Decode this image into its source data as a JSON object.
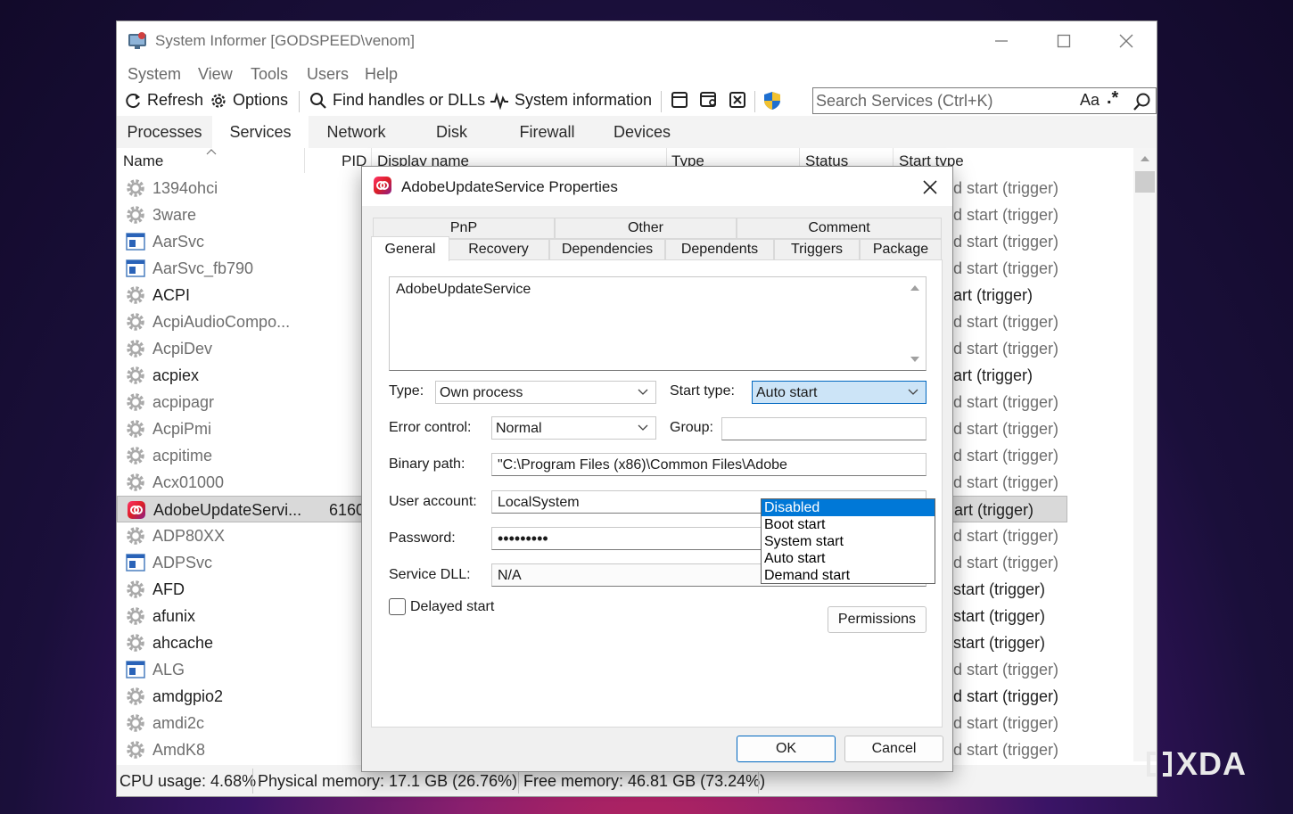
{
  "window": {
    "title": "System Informer [GODSPEED\\venom]"
  },
  "menu": [
    "System",
    "View",
    "Tools",
    "Users",
    "Help"
  ],
  "toolbar": {
    "refresh": "Refresh",
    "options": "Options",
    "find_handles": "Find handles or DLLs",
    "system_information": "System information",
    "search_placeholder": "Search Services (Ctrl+K)",
    "match_case": "Aa",
    "regex": ".*"
  },
  "tabs": [
    "Processes",
    "Services",
    "Network",
    "Disk",
    "Firewall",
    "Devices"
  ],
  "columns": {
    "name": "Name",
    "pid": "PID",
    "display_name": "Display name",
    "type": "Type",
    "status": "Status",
    "start_type": "Start type"
  },
  "services": [
    {
      "name": "1394ohci",
      "pid": "",
      "start": "d start (trigger)",
      "icon": "gear-icon"
    },
    {
      "name": "3ware",
      "pid": "",
      "start": "d start (trigger)",
      "icon": "gear-icon"
    },
    {
      "name": "AarSvc",
      "pid": "",
      "start": "d start (trigger)",
      "icon": "window-icon"
    },
    {
      "name": "AarSvc_fb790",
      "pid": "",
      "start": "d start (trigger)",
      "icon": "window-icon"
    },
    {
      "name": "ACPI",
      "pid": "",
      "start": "art (trigger)",
      "icon": "gear-icon",
      "dark": true
    },
    {
      "name": "AcpiAudioCompo...",
      "pid": "",
      "start": "d start (trigger)",
      "icon": "gear-icon"
    },
    {
      "name": "AcpiDev",
      "pid": "",
      "start": "d start (trigger)",
      "icon": "gear-icon"
    },
    {
      "name": "acpiex",
      "pid": "",
      "start": "art (trigger)",
      "icon": "gear-icon",
      "dark": true
    },
    {
      "name": "acpipagr",
      "pid": "",
      "start": "d start (trigger)",
      "icon": "gear-icon"
    },
    {
      "name": "AcpiPmi",
      "pid": "",
      "start": "d start (trigger)",
      "icon": "gear-icon"
    },
    {
      "name": "acpitime",
      "pid": "",
      "start": "d start (trigger)",
      "icon": "gear-icon"
    },
    {
      "name": "Acx01000",
      "pid": "",
      "start": "d start (trigger)",
      "icon": "gear-icon"
    },
    {
      "name": "AdobeUpdateServi...",
      "pid": "6160",
      "start": "art (trigger)",
      "icon": "adobe-icon",
      "dark": true,
      "selected": true
    },
    {
      "name": "ADP80XX",
      "pid": "",
      "start": "d start (trigger)",
      "icon": "gear-icon"
    },
    {
      "name": "ADPSvc",
      "pid": "",
      "start": "d start (trigger)",
      "icon": "window-icon"
    },
    {
      "name": "AFD",
      "pid": "",
      "start": "start (trigger)",
      "icon": "gear-icon",
      "dark": true
    },
    {
      "name": "afunix",
      "pid": "",
      "start": "start (trigger)",
      "icon": "gear-icon",
      "dark": true
    },
    {
      "name": "ahcache",
      "pid": "",
      "start": "start (trigger)",
      "icon": "gear-icon",
      "dark": true
    },
    {
      "name": "ALG",
      "pid": "",
      "start": "d start (trigger)",
      "icon": "window-icon"
    },
    {
      "name": "amdgpio2",
      "pid": "",
      "start": "d start (trigger)",
      "icon": "gear-icon",
      "dark": true
    },
    {
      "name": "amdi2c",
      "pid": "",
      "start": "d start (trigger)",
      "icon": "gear-icon"
    },
    {
      "name": "AmdK8",
      "pid": "",
      "start": "d start (trigger)",
      "icon": "gear-icon"
    }
  ],
  "status": {
    "cpu": "CPU usage: 4.68%",
    "physical": "Physical memory: 17.1 GB (26.76%)",
    "free": "Free memory: 46.81 GB (73.24%)"
  },
  "dialog": {
    "title": "AdobeUpdateService Properties",
    "tabs_row1": [
      "PnP",
      "Other",
      "Comment"
    ],
    "tabs_row2": [
      "General",
      "Recovery",
      "Dependencies",
      "Dependents",
      "Triggers",
      "Package"
    ],
    "description": "AdobeUpdateService",
    "type_label": "Type:",
    "type_value": "Own process",
    "start_type_label": "Start type:",
    "start_type_value": "Auto start",
    "start_type_options": [
      "Disabled",
      "Boot start",
      "System start",
      "Auto start",
      "Demand start"
    ],
    "error_control_label": "Error control:",
    "error_control_value": "Normal",
    "group_label": "Group:",
    "binary_path_label": "Binary path:",
    "binary_path_value": "\"C:\\Program Files (x86)\\Common Files\\Adobe",
    "user_account_label": "User account:",
    "user_account_value": "LocalSystem",
    "password_label": "Password:",
    "password_value": "•••••••••",
    "service_dll_label": "Service DLL:",
    "service_dll_value": "N/A",
    "delayed_start_label": "Delayed start",
    "permissions_button": "Permissions",
    "ok_button": "OK",
    "cancel_button": "Cancel"
  },
  "watermark": "XDA"
}
